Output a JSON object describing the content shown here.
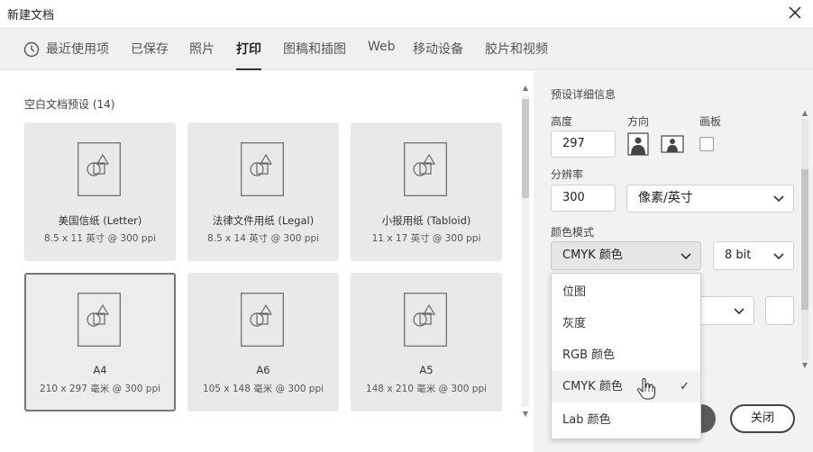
{
  "window": {
    "title": "新建文档"
  },
  "tabs": [
    {
      "label": "最近使用项",
      "icon": "clock-icon"
    },
    {
      "label": "已保存"
    },
    {
      "label": "照片"
    },
    {
      "label": "打印",
      "active": true
    },
    {
      "label": "图稿和插图"
    },
    {
      "label": "Web"
    },
    {
      "label": "移动设备"
    },
    {
      "label": "胶片和视频"
    }
  ],
  "presets": {
    "section_label": "空白文档预设",
    "count": "(14)",
    "items": [
      {
        "name": "美国信纸 (Letter)",
        "size": "8.5 x 11 英寸 @ 300 ppi"
      },
      {
        "name": "法律文件用纸 (Legal)",
        "size": "8.5 x 14 英寸 @ 300 ppi"
      },
      {
        "name": "小报用纸 (Tabloid)",
        "size": "11 x 17 英寸 @ 300 ppi"
      },
      {
        "name": "A4",
        "size": "210 x 297 毫米 @ 300 ppi",
        "selected": true
      },
      {
        "name": "A6",
        "size": "105 x 148 毫米 @ 300 ppi"
      },
      {
        "name": "A5",
        "size": "148 x 210 毫米 @ 300 ppi"
      }
    ]
  },
  "details": {
    "section_label": "预设详细信息",
    "height_label": "高度",
    "height_value": "297",
    "orientation_label": "方向",
    "artboard_label": "画板",
    "resolution_label": "分辨率",
    "resolution_value": "300",
    "resolution_unit": "像素/英寸",
    "color_mode_label": "颜色模式",
    "color_mode_value": "CMYK 颜色",
    "bit_depth_value": "8 bit"
  },
  "color_mode_dropdown": {
    "options": [
      "位图",
      "灰度",
      "RGB 颜色",
      "CMYK 颜色",
      "Lab 颜色"
    ],
    "selected_index": 3,
    "check": "✓"
  },
  "buttons": {
    "close_label": "关闭"
  },
  "colors": {
    "accent": "#333333",
    "pane_bg": "#f2f2f2",
    "card_bg": "#e9e9e9"
  }
}
